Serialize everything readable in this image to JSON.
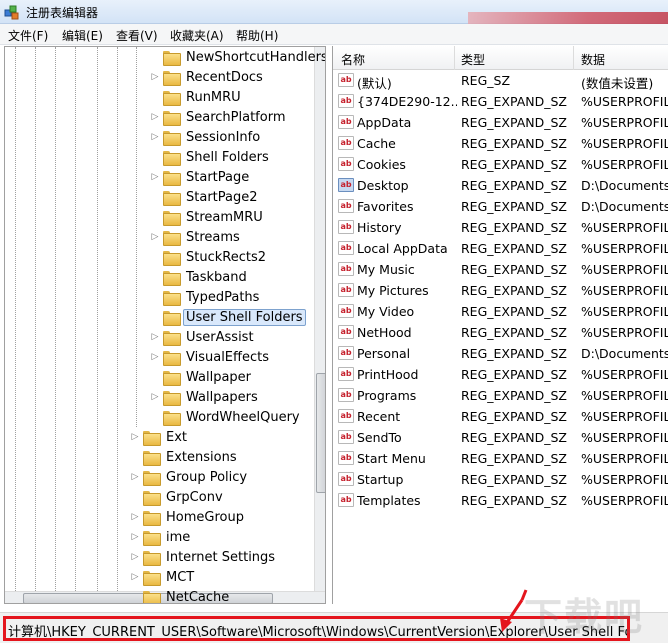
{
  "window": {
    "title": "注册表编辑器",
    "accent": "#e4151d"
  },
  "menu": [
    "文件(F)",
    "编辑(E)",
    "查看(V)",
    "收藏夹(A)",
    "帮助(H)"
  ],
  "tree": [
    {
      "label": "NewShortcutHandlers",
      "level": 2,
      "expander": ""
    },
    {
      "label": "RecentDocs",
      "level": 2,
      "expander": "▷"
    },
    {
      "label": "RunMRU",
      "level": 2,
      "expander": ""
    },
    {
      "label": "SearchPlatform",
      "level": 2,
      "expander": "▷"
    },
    {
      "label": "SessionInfo",
      "level": 2,
      "expander": "▷"
    },
    {
      "label": "Shell Folders",
      "level": 2,
      "expander": ""
    },
    {
      "label": "StartPage",
      "level": 2,
      "expander": "▷"
    },
    {
      "label": "StartPage2",
      "level": 2,
      "expander": ""
    },
    {
      "label": "StreamMRU",
      "level": 2,
      "expander": ""
    },
    {
      "label": "Streams",
      "level": 2,
      "expander": "▷"
    },
    {
      "label": "StuckRects2",
      "level": 2,
      "expander": ""
    },
    {
      "label": "Taskband",
      "level": 2,
      "expander": ""
    },
    {
      "label": "TypedPaths",
      "level": 2,
      "expander": ""
    },
    {
      "label": "User Shell Folders",
      "level": 2,
      "expander": "",
      "selected": true
    },
    {
      "label": "UserAssist",
      "level": 2,
      "expander": "▷"
    },
    {
      "label": "VisualEffects",
      "level": 2,
      "expander": "▷"
    },
    {
      "label": "Wallpaper",
      "level": 2,
      "expander": ""
    },
    {
      "label": "Wallpapers",
      "level": 2,
      "expander": "▷"
    },
    {
      "label": "WordWheelQuery",
      "level": 2,
      "expander": ""
    },
    {
      "label": "Ext",
      "level": 1,
      "expander": "▷"
    },
    {
      "label": "Extensions",
      "level": 1,
      "expander": ""
    },
    {
      "label": "Group Policy",
      "level": 1,
      "expander": "▷"
    },
    {
      "label": "GrpConv",
      "level": 1,
      "expander": ""
    },
    {
      "label": "HomeGroup",
      "level": 1,
      "expander": "▷"
    },
    {
      "label": "ime",
      "level": 1,
      "expander": "▷"
    },
    {
      "label": "Internet Settings",
      "level": 1,
      "expander": "▷"
    },
    {
      "label": "MCT",
      "level": 1,
      "expander": "▷"
    },
    {
      "label": "NetCache",
      "level": 1,
      "expander": ""
    }
  ],
  "list": {
    "columns": [
      "名称",
      "类型",
      "数据"
    ],
    "rows": [
      {
        "name": "(默认)",
        "type": "REG_SZ",
        "data": "(数值未设置)"
      },
      {
        "name": "{374DE290-12...",
        "type": "REG_EXPAND_SZ",
        "data": "%USERPROFILE"
      },
      {
        "name": "AppData",
        "type": "REG_EXPAND_SZ",
        "data": "%USERPROFILE"
      },
      {
        "name": "Cache",
        "type": "REG_EXPAND_SZ",
        "data": "%USERPROFILE"
      },
      {
        "name": "Cookies",
        "type": "REG_EXPAND_SZ",
        "data": "%USERPROFILE"
      },
      {
        "name": "Desktop",
        "type": "REG_EXPAND_SZ",
        "data": "D:\\Documents\\",
        "selected": true
      },
      {
        "name": "Favorites",
        "type": "REG_EXPAND_SZ",
        "data": "D:\\Documents\\"
      },
      {
        "name": "History",
        "type": "REG_EXPAND_SZ",
        "data": "%USERPROFILE"
      },
      {
        "name": "Local AppData",
        "type": "REG_EXPAND_SZ",
        "data": "%USERPROFILE"
      },
      {
        "name": "My Music",
        "type": "REG_EXPAND_SZ",
        "data": "%USERPROFILE"
      },
      {
        "name": "My Pictures",
        "type": "REG_EXPAND_SZ",
        "data": "%USERPROFILE"
      },
      {
        "name": "My Video",
        "type": "REG_EXPAND_SZ",
        "data": "%USERPROFILE"
      },
      {
        "name": "NetHood",
        "type": "REG_EXPAND_SZ",
        "data": "%USERPROFILE"
      },
      {
        "name": "Personal",
        "type": "REG_EXPAND_SZ",
        "data": "D:\\Documents"
      },
      {
        "name": "PrintHood",
        "type": "REG_EXPAND_SZ",
        "data": "%USERPROFILE"
      },
      {
        "name": "Programs",
        "type": "REG_EXPAND_SZ",
        "data": "%USERPROFILE"
      },
      {
        "name": "Recent",
        "type": "REG_EXPAND_SZ",
        "data": "%USERPROFILE"
      },
      {
        "name": "SendTo",
        "type": "REG_EXPAND_SZ",
        "data": "%USERPROFILE"
      },
      {
        "name": "Start Menu",
        "type": "REG_EXPAND_SZ",
        "data": "%USERPROFILE"
      },
      {
        "name": "Startup",
        "type": "REG_EXPAND_SZ",
        "data": "%USERPROFILE"
      },
      {
        "name": "Templates",
        "type": "REG_EXPAND_SZ",
        "data": "%USERPROFILE"
      }
    ]
  },
  "status": {
    "path": "计算机\\HKEY_CURRENT_USER\\Software\\Microsoft\\Windows\\CurrentVersion\\Explorer\\User Shell Folders"
  },
  "icons": {
    "app": "registry-icon",
    "folder": "folder-icon",
    "value": "string-value-icon"
  }
}
